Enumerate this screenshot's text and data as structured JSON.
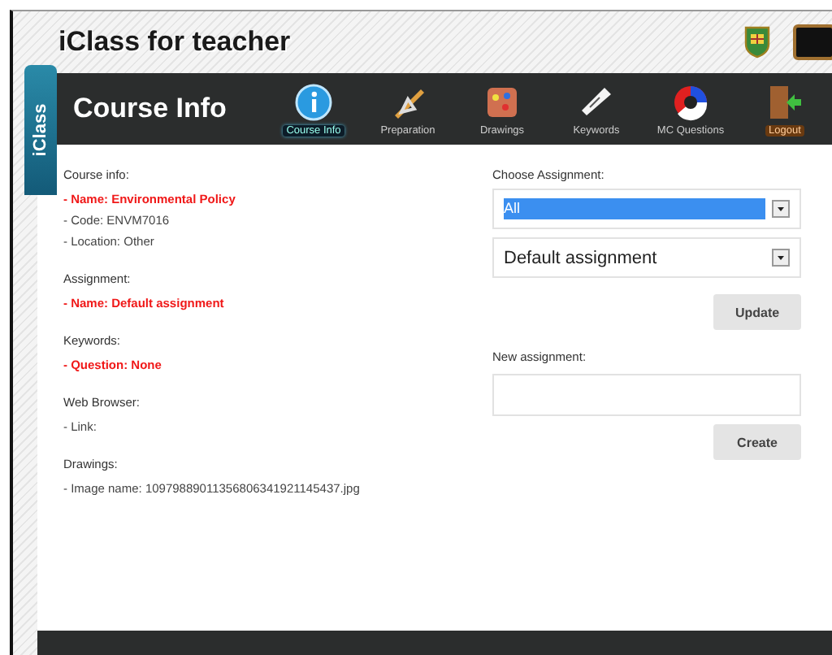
{
  "header": {
    "logo": "iClass for teacher"
  },
  "side_tab": {
    "label": "iClass"
  },
  "nav": {
    "title": "Course Info",
    "items": [
      {
        "label": "Course Info",
        "selected": true,
        "kind": "page"
      },
      {
        "label": "Preparation",
        "selected": false,
        "kind": "page"
      },
      {
        "label": "Drawings",
        "selected": false,
        "kind": "page"
      },
      {
        "label": "Keywords",
        "selected": false,
        "kind": "page"
      },
      {
        "label": "MC Questions",
        "selected": false,
        "kind": "page"
      },
      {
        "label": "Logout",
        "selected": false,
        "kind": "logout"
      }
    ]
  },
  "info": [
    {
      "heading": "Course info:",
      "lines": [
        {
          "text": "- Name: Environmental Policy",
          "highlight": true
        },
        {
          "text": "- Code: ENVM7016",
          "highlight": false
        },
        {
          "text": "- Location: Other",
          "highlight": false
        }
      ]
    },
    {
      "heading": "Assignment:",
      "lines": [
        {
          "text": "- Name: Default assignment",
          "highlight": true
        }
      ]
    },
    {
      "heading": "Keywords:",
      "lines": [
        {
          "text": "- Question: None",
          "highlight": true
        }
      ]
    },
    {
      "heading": "Web Browser:",
      "lines": [
        {
          "text": "- Link:",
          "highlight": false
        }
      ]
    },
    {
      "heading": "Drawings:",
      "lines": [
        {
          "text": "- Image name: 10979889011356806341921145437.jpg",
          "highlight": false
        }
      ]
    }
  ],
  "assignment": {
    "label": "Choose Assignment:",
    "selects": [
      {
        "value": "All",
        "highlighted": true
      },
      {
        "value": "Default assignment",
        "highlighted": false
      }
    ],
    "update_button": "Update",
    "new_label": "New assignment:",
    "create_button": "Create"
  }
}
